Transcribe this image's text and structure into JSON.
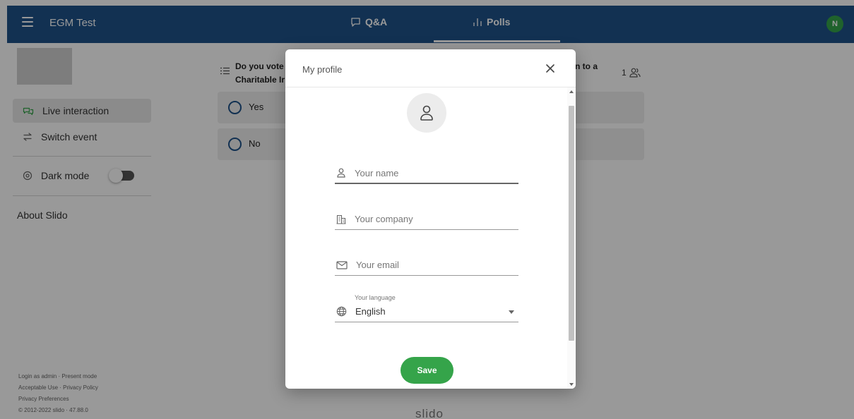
{
  "header": {
    "event_title": "EGM Test",
    "tabs": [
      {
        "label": "Q&A",
        "icon": "chat-bubble-icon"
      },
      {
        "label": "Polls",
        "icon": "bar-chart-icon",
        "active": true
      }
    ],
    "user_initial": "N",
    "bar_color": "#1f5289"
  },
  "sidebar": {
    "items": [
      {
        "label": "Live interaction",
        "icon": "chat-bubbles-icon",
        "active": true
      },
      {
        "label": "Switch event",
        "icon": "swap-arrows-icon"
      },
      {
        "label": "Dark mode",
        "icon": "settings-icon",
        "toggle": false
      },
      {
        "label": "About Slido"
      }
    ],
    "footer": {
      "line1": "Login as admin · Present mode",
      "line2": "Acceptable Use · Privacy Policy",
      "line3": "Privacy Preferences",
      "line4": "© 2012-2022 slido · 47.88.0"
    }
  },
  "poll": {
    "question_part1": "Do you vote",
    "question_part2": "Charitable Ir",
    "question_right": "n to a",
    "participants": "1",
    "options": [
      {
        "label": "Yes"
      },
      {
        "label": "No"
      }
    ]
  },
  "brand": "slido",
  "modal": {
    "title": "My profile",
    "name_placeholder": "Your name",
    "company_placeholder": "Your company",
    "email_placeholder": "Your email",
    "language_label": "Your language",
    "language_value": "English",
    "save_label": "Save",
    "accent": "#35a44a"
  }
}
